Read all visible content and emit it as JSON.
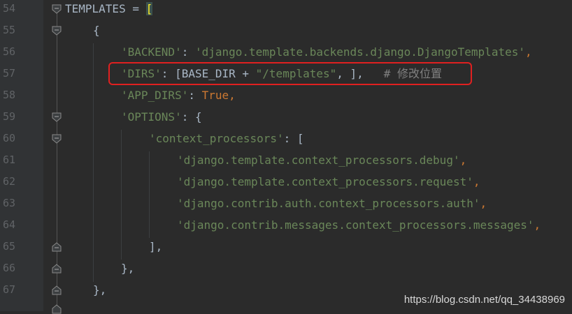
{
  "editor": {
    "lines": [
      {
        "no": "54"
      },
      {
        "no": "55"
      },
      {
        "no": "56"
      },
      {
        "no": "57"
      },
      {
        "no": "58"
      },
      {
        "no": "59"
      },
      {
        "no": "60"
      },
      {
        "no": "61"
      },
      {
        "no": "62"
      },
      {
        "no": "63"
      },
      {
        "no": "64"
      },
      {
        "no": "65"
      },
      {
        "no": "66"
      },
      {
        "no": "67"
      }
    ],
    "code": {
      "l54_name": "TEMPLATES",
      "l54_eq": " = ",
      "l54_bracket": "[",
      "l55": "{",
      "l56_key": "'BACKEND'",
      "l56_colon": ": ",
      "l56_val": "'django.template.backends.django.DjangoTemplates'",
      "l56_comma": ",",
      "l57_key": "'DIRS'",
      "l57_a": ": [BASE_DIR + ",
      "l57_str": "\"/templates\"",
      "l57_b": ", ],   ",
      "l57_comment": "# 修改位置",
      "l58_key": "'APP_DIRS'",
      "l58_colon": ": ",
      "l58_val": "True",
      "l58_comma": ",",
      "l59_key": "'OPTIONS'",
      "l59_rest": ": {",
      "l60_key": "'context_processors'",
      "l60_rest": ": [",
      "l61": "'django.template.context_processors.debug'",
      "l62": "'django.template.context_processors.request'",
      "l63": "'django.contrib.auth.context_processors.auth'",
      "l64": "'django.contrib.messages.context_processors.messages'",
      "comma": ",",
      "l65": "],",
      "l66": "},",
      "l67": "},"
    }
  },
  "watermark": "https://blog.csdn.net/qq_34438969",
  "colors": {
    "background": "#2b2b2b",
    "string": "#6a8759",
    "keyword": "#cc7832",
    "default": "#a9b7c6",
    "highlight_border": "#e02020"
  }
}
